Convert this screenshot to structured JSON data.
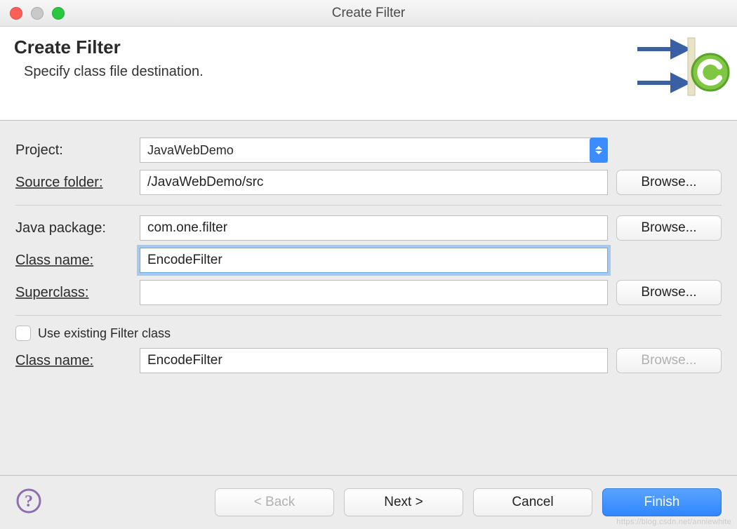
{
  "window": {
    "title": "Create Filter"
  },
  "header": {
    "title": "Create Filter",
    "subtitle": "Specify class file destination."
  },
  "form": {
    "project_label": "Project:",
    "project_value": "JavaWebDemo",
    "source_folder_label": "Source folder:",
    "source_folder_value": "/JavaWebDemo/src",
    "java_package_label": "Java package:",
    "java_package_value": "com.one.filter",
    "class_name_label": "Class name:",
    "class_name_value": "EncodeFilter",
    "superclass_label": "Superclass:",
    "superclass_value": "",
    "use_existing_label": "Use existing Filter class",
    "use_existing_checked": false,
    "existing_class_name_label": "Class name:",
    "existing_class_name_value": "EncodeFilter",
    "browse_label": "Browse..."
  },
  "footer": {
    "back_label": "< Back",
    "next_label": "Next >",
    "cancel_label": "Cancel",
    "finish_label": "Finish"
  },
  "watermark": "https://blog.csdn.net/anniewhite"
}
